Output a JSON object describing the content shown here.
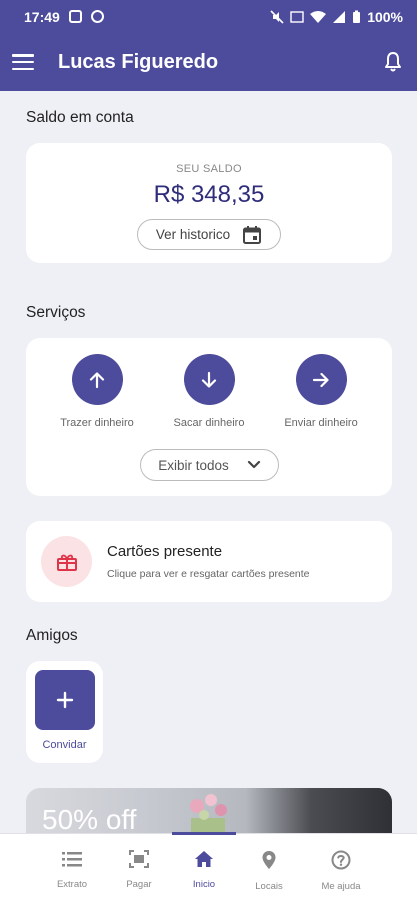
{
  "status_bar": {
    "time": "17:49",
    "battery": "100%"
  },
  "app_bar": {
    "title": "Lucas Figueredo"
  },
  "balance_section": {
    "title": "Saldo em conta",
    "label": "SEU SALDO",
    "value": "R$ 348,35",
    "history_button": "Ver historico"
  },
  "services_section": {
    "title": "Serviços",
    "items": [
      {
        "label": "Trazer dinheiro",
        "icon": "arrow-up-icon"
      },
      {
        "label": "Sacar dinheiro",
        "icon": "arrow-down-icon"
      },
      {
        "label": "Enviar dinheiro",
        "icon": "arrow-right-icon"
      }
    ],
    "show_all_button": "Exibir todos"
  },
  "gift_cards": {
    "title": "Cartões presente",
    "subtitle": "Clique para ver e resgatar cartões presente",
    "icon": "gift-icon"
  },
  "friends_section": {
    "title": "Amigos",
    "invite_label": "Convidar"
  },
  "promo": {
    "text": "50% off"
  },
  "bottom_nav": {
    "active": "Inicio",
    "items": [
      {
        "label": "Extrato",
        "icon": "list-icon"
      },
      {
        "label": "Pagar",
        "icon": "scan-icon"
      },
      {
        "label": "Inicio",
        "icon": "home-icon"
      },
      {
        "label": "Locais",
        "icon": "location-pin-icon"
      },
      {
        "label": "Me ajuda",
        "icon": "help-icon"
      }
    ]
  },
  "colors": {
    "primary": "#4d4b9c",
    "balance_text": "#2f2d7a",
    "gift_icon": "#e0344a",
    "background": "#eef0f6"
  }
}
